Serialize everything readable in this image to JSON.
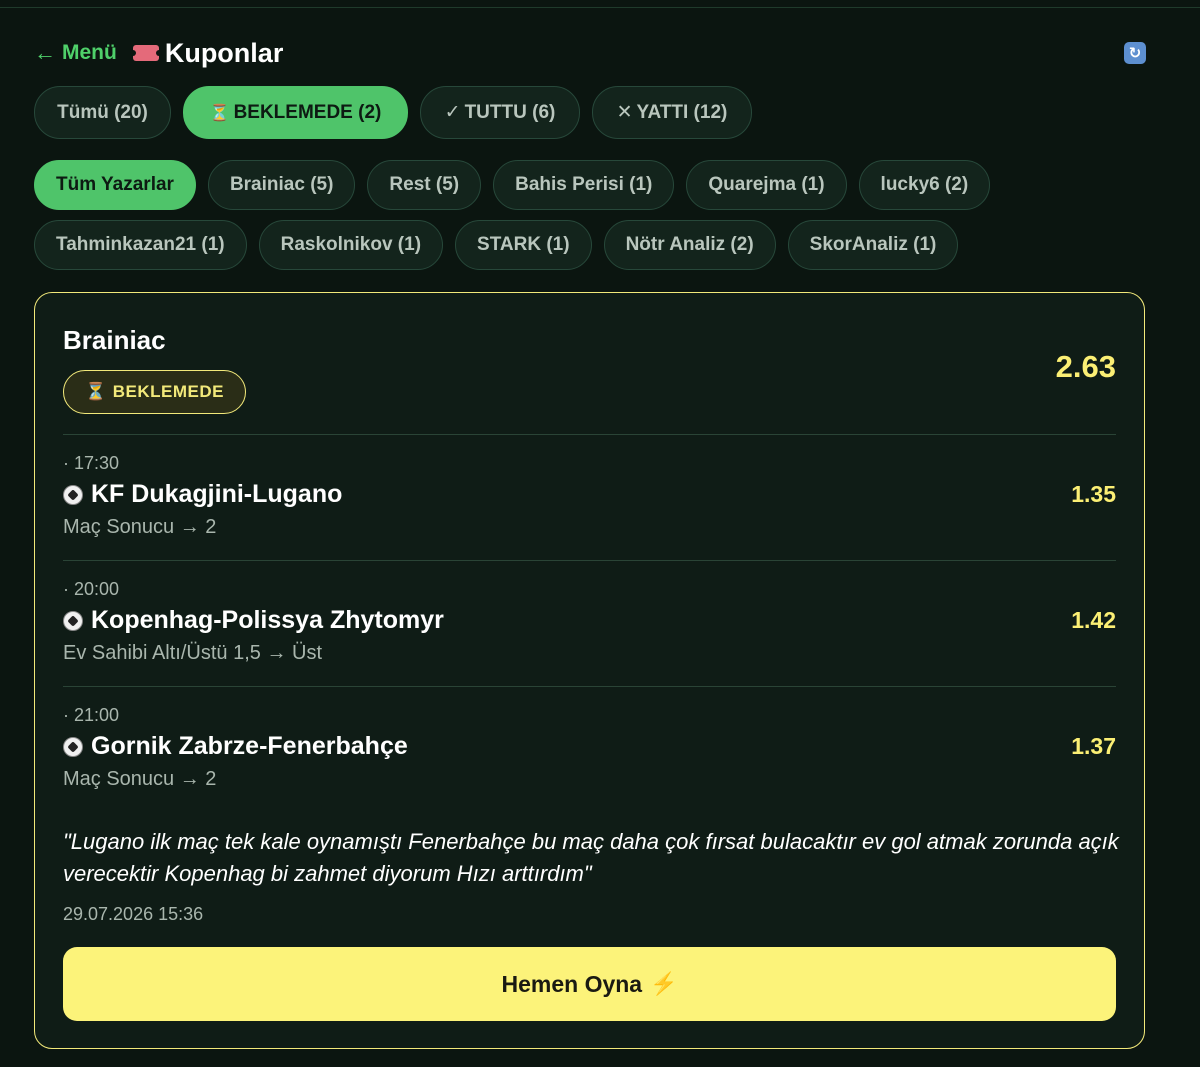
{
  "header": {
    "back_label": "Menü",
    "title": "Kuponlar",
    "icons": {
      "back": "left-arrow-icon",
      "title": "ticket-icon",
      "refresh": "refresh-icon"
    }
  },
  "status_filters": [
    {
      "label": "Tümü (20)",
      "active": false
    },
    {
      "label": "BEKLEMEDE (2)",
      "icon": "hourglass-icon",
      "active": true
    },
    {
      "label": "TUTTU (6)",
      "icon": "check-icon",
      "active": false
    },
    {
      "label": "YATTI (12)",
      "icon": "x-icon",
      "active": false
    }
  ],
  "author_filters": [
    {
      "label": "Tüm Yazarlar",
      "active": true
    },
    {
      "label": "Brainiac (5)"
    },
    {
      "label": "Rest (5)"
    },
    {
      "label": "Bahis Perisi (1)"
    },
    {
      "label": "Quarejma (1)"
    },
    {
      "label": "lucky6 (2)"
    },
    {
      "label": "Tahminkazan21 (1)"
    },
    {
      "label": "Raskolnikov (1)"
    },
    {
      "label": "STARK (1)"
    },
    {
      "label": "Nötr Analiz (2)"
    },
    {
      "label": "SkorAnaliz (1)"
    }
  ],
  "coupon": {
    "author": "Brainiac",
    "status": "BEKLEMEDE",
    "total_odds": "2.63",
    "matches": [
      {
        "time": "· 17:30",
        "name": "KF Dukagjini-Lugano",
        "pick": "Maç Sonucu → 2",
        "odds": "1.35"
      },
      {
        "time": "· 20:00",
        "name": "Kopenhag-Polissya Zhytomyr",
        "pick": "Ev Sahibi Altı/Üstü 1,5 → Üst",
        "odds": "1.42"
      },
      {
        "time": "· 21:00",
        "name": "Gornik Zabrze-Fenerbahçe",
        "pick": "Maç Sonucu → 2",
        "odds": "1.37"
      }
    ],
    "comment": "\"Lugano ilk maç tek kale oynamıştı Fenerbahçe bu maç daha çok fırsat bulacaktır ev gol atmak zorunda açık verecektir Kopenhag bi zahmet diyorum Hızı arttırdım\"",
    "timestamp": "29.07.2026 15:36",
    "cta_label": "Hemen Oyna"
  },
  "colors": {
    "background": "#0b1510",
    "accent_green": "#4fc46a",
    "accent_yellow": "#fcf37a",
    "odds_yellow": "#fbef74"
  }
}
